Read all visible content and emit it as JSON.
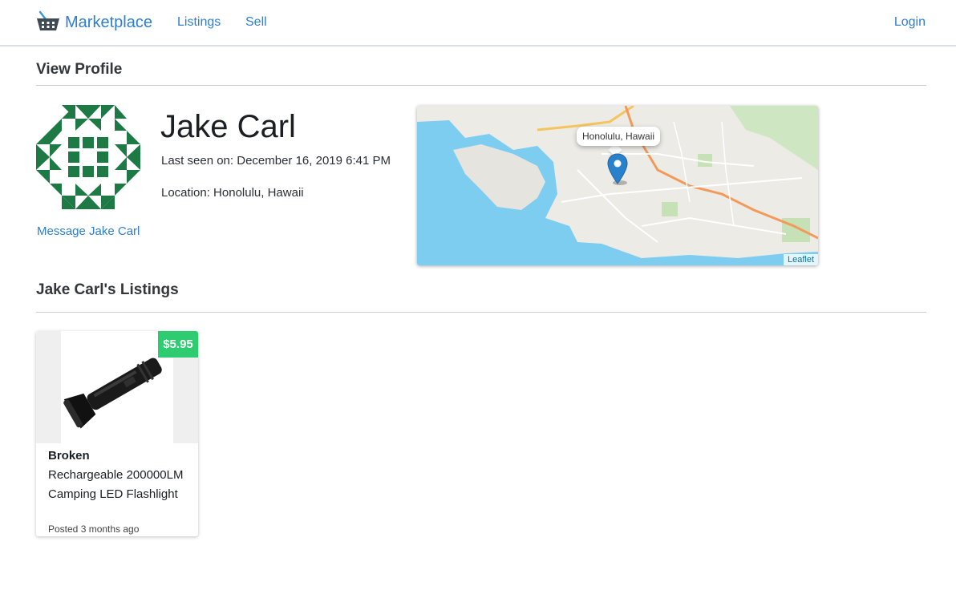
{
  "nav": {
    "brand": "Marketplace",
    "links": [
      "Listings",
      "Sell"
    ],
    "login": "Login"
  },
  "profile": {
    "section_title": "View Profile",
    "name": "Jake Carl",
    "last_seen": "Last seen on: December 16, 2019 6:41 PM",
    "location": "Location: Honolulu, Hawaii",
    "message_link": "Message Jake Carl",
    "avatar_color": "#1e7a45"
  },
  "map": {
    "popup": "Honolulu, Hawaii",
    "attribution": "Leaflet",
    "marker_color": "#2a81cb",
    "water_color": "#7ccdf0"
  },
  "listings": {
    "section_title": "Jake Carl's Listings",
    "items": [
      {
        "title_bold": "Broken",
        "title_rest": "Rechargeable 200000LM Camping LED Flashlight",
        "price": "$5.95",
        "posted": "Posted 3 months ago",
        "price_color": "#2ecc71"
      }
    ]
  }
}
